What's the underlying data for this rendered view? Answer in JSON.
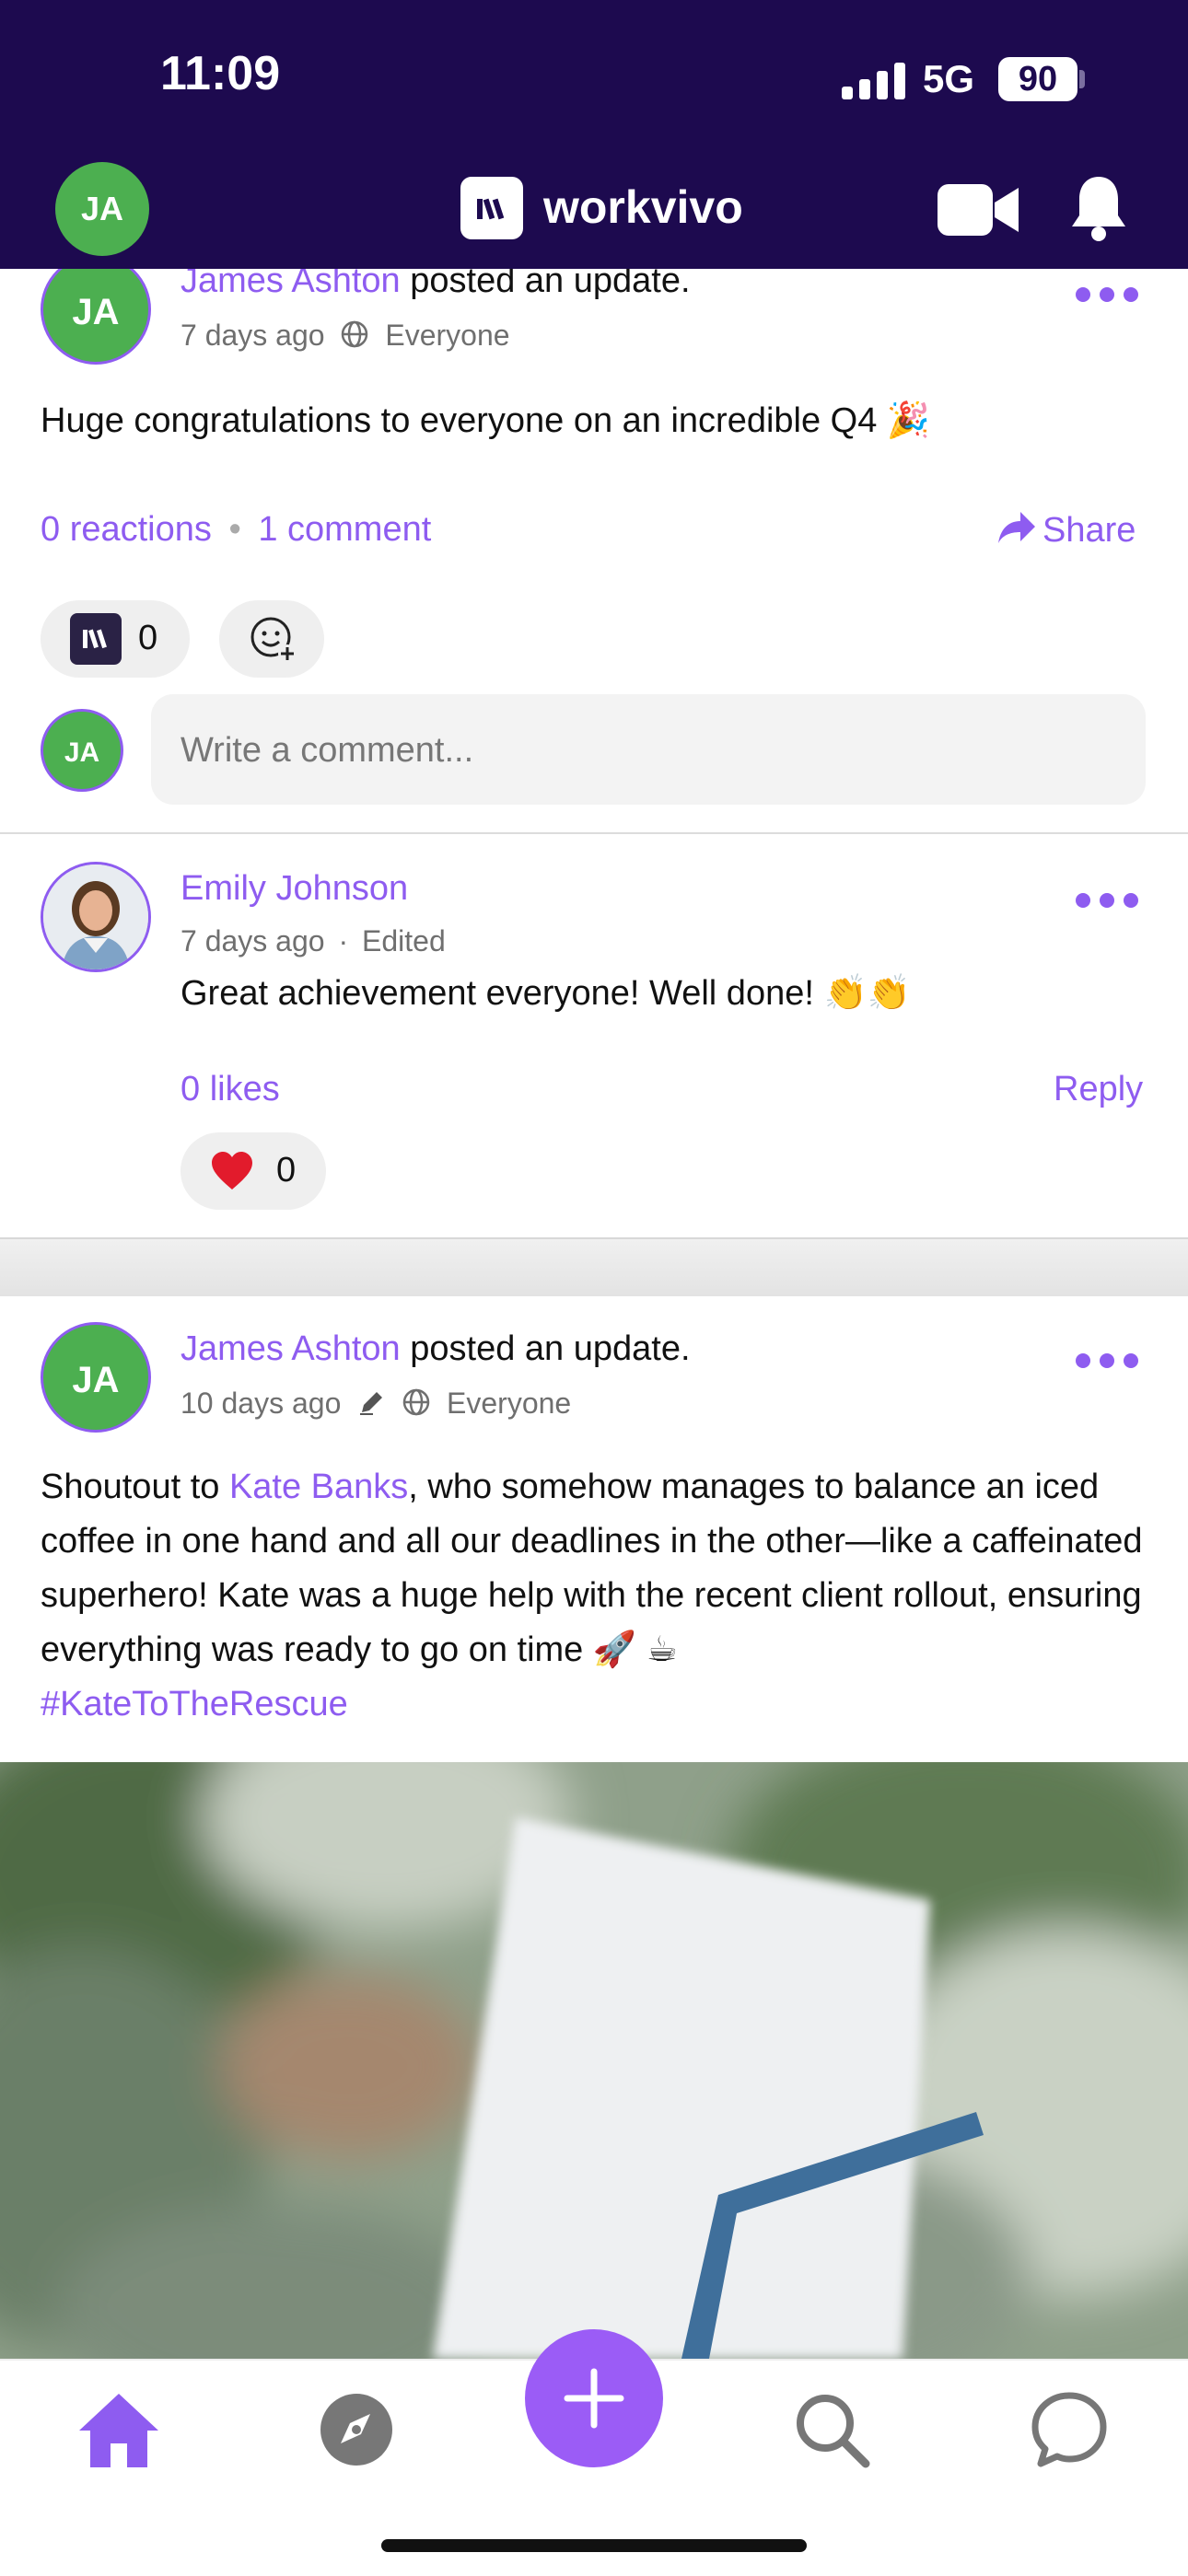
{
  "status_bar": {
    "time": "11:09",
    "network": "5G",
    "battery": "90"
  },
  "header": {
    "avatar_initials": "JA",
    "brand": "workvivo"
  },
  "post1": {
    "author": "James Ashton",
    "action": "posted an update.",
    "time": "7 days ago",
    "audience": "Everyone",
    "text": "Huge congratulations to everyone on an incredible Q4 🎉",
    "reactions_label": "0 reactions",
    "separator": "•",
    "comments_label": "1 comment",
    "share_label": "Share",
    "reaction_count": "0",
    "comment_placeholder": "Write a comment...",
    "commenter_initials": "JA"
  },
  "comment1": {
    "author": "Emily Johnson",
    "time": "7 days ago",
    "edited": "Edited",
    "text": "Great achievement everyone! Well done! 👏👏",
    "likes_label": "0 likes",
    "reply_label": "Reply",
    "heart_count": "0"
  },
  "post2": {
    "author": "James Ashton",
    "action": "posted an update.",
    "time": "10 days ago",
    "audience": "Everyone",
    "text_before": "Shoutout to ",
    "mention": "Kate Banks",
    "text_after": ", who somehow manages to balance an iced coffee in one hand and all our deadlines in the other—like a caffeinated superhero! Kate was a huge help with the recent client rollout, ensuring everything was ready to go on time 🚀 ☕",
    "hashtag": "#KateToTheRescue"
  },
  "colors": {
    "header_bg": "#1d0a4f",
    "accent": "#8e5cf0",
    "avatar_green": "#4caf50"
  },
  "icons": [
    "signal-icon",
    "battery-icon",
    "workvivo-logo-icon",
    "video-icon",
    "bell-icon",
    "more-icon",
    "globe-icon",
    "share-icon",
    "add-reaction-icon",
    "heart-icon",
    "pencil-icon",
    "home-icon",
    "compass-icon",
    "plus-icon",
    "search-icon",
    "chat-icon"
  ]
}
